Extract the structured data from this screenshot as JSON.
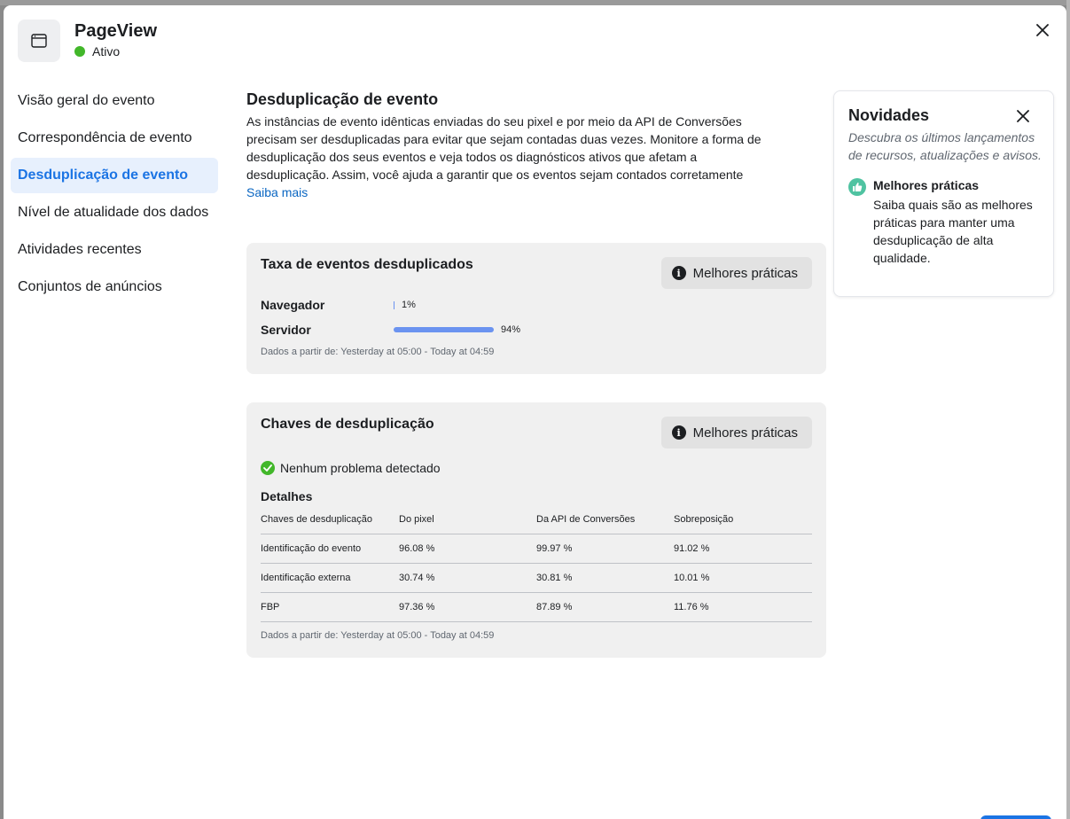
{
  "header": {
    "title": "PageView",
    "status": "Ativo",
    "status_color": "#42b72a"
  },
  "sidebar": {
    "items": [
      {
        "label": "Visão geral do evento"
      },
      {
        "label": "Correspondência de evento"
      },
      {
        "label": "Desduplicação de evento",
        "active": true
      },
      {
        "label": "Nível de atualidade dos dados"
      },
      {
        "label": "Atividades recentes"
      },
      {
        "label": "Conjuntos de anúncios"
      }
    ]
  },
  "main": {
    "title": "Desduplicação de evento",
    "description": "As instâncias de evento idênticas enviadas do seu pixel e por meio da API de Conversões precisam ser desduplicadas para evitar que sejam contadas duas vezes. Monitore a forma de desduplicação dos seus eventos e veja todos os diagnósticos ativos que afetam a desduplicação. Assim, você ajuda a garantir que os eventos sejam contados corretamente",
    "learn_more": "Saiba mais"
  },
  "rate_card": {
    "title": "Taxa de eventos desduplicados",
    "button": "Melhores práticas",
    "rows": [
      {
        "label": "Navegador",
        "value": "1%",
        "fraction": 0.01
      },
      {
        "label": "Servidor",
        "value": "94%",
        "fraction": 0.94
      }
    ],
    "note": "Dados a partir de: Yesterday at 05:00 - Today at 04:59"
  },
  "keys_card": {
    "title": "Chaves de desduplicação",
    "button": "Melhores práticas",
    "status": "Nenhum problema detectado",
    "details_title": "Detalhes",
    "columns": [
      "Chaves de desduplicação",
      "Do pixel",
      "Da API de Conversões",
      "Sobreposição"
    ],
    "rows": [
      [
        "Identificação do evento",
        "96.08 %",
        "99.97 %",
        "91.02 %"
      ],
      [
        "Identificação externa",
        "30.74 %",
        "30.81 %",
        "10.01 %"
      ],
      [
        "FBP",
        "97.36 %",
        "87.89 %",
        "11.76 %"
      ]
    ],
    "note": "Dados a partir de: Yesterday at 05:00 - Today at 04:59"
  },
  "news": {
    "title": "Novidades",
    "subtitle": "Descubra os últimos lançamentos de recursos, atualizações e avisos.",
    "item_title": "Melhores práticas",
    "item_text": "Saiba quais são as melhores práticas para manter uma desduplicação de alta qualidade."
  },
  "colors": {
    "accent": "#1b74e4",
    "bar": "#6b93f0",
    "ok": "#42b72a",
    "thumb": "#4fc3a1"
  }
}
